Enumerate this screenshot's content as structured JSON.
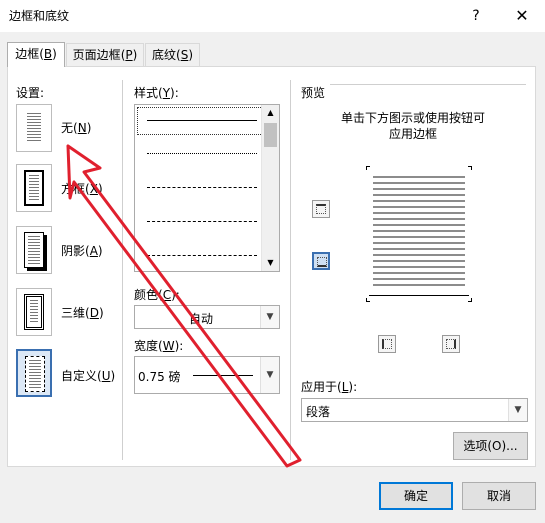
{
  "window": {
    "title": "边框和底纹",
    "help": "?",
    "close": "✕"
  },
  "tabs": [
    {
      "label_main": "边框",
      "label_key": "B"
    },
    {
      "label_main": "页面边框",
      "label_key": "P"
    },
    {
      "label_main": "底纹",
      "label_key": "S"
    }
  ],
  "settings": {
    "label": "设置:",
    "items": [
      {
        "main": "无",
        "key": "N"
      },
      {
        "main": "方框",
        "key": "X"
      },
      {
        "main": "阴影",
        "key": "A"
      },
      {
        "main": "三维",
        "key": "D"
      },
      {
        "main": "自定义",
        "key": "U"
      }
    ]
  },
  "style": {
    "label_main": "样式",
    "label_key": "Y"
  },
  "color": {
    "label_main": "颜色",
    "label_key": "C",
    "value": "自动"
  },
  "width": {
    "label_main": "宽度",
    "label_key": "W",
    "value": "0.75 磅"
  },
  "preview": {
    "label": "预览",
    "instruction_line1": "单击下方图示或使用按钮可",
    "instruction_line2": "应用边框"
  },
  "apply_to": {
    "label_main": "应用于",
    "label_key": "L",
    "value": "段落"
  },
  "buttons": {
    "options": "选项(O)...",
    "ok": "确定",
    "cancel": "取消"
  },
  "annotation": {
    "color": "#e0202e"
  }
}
